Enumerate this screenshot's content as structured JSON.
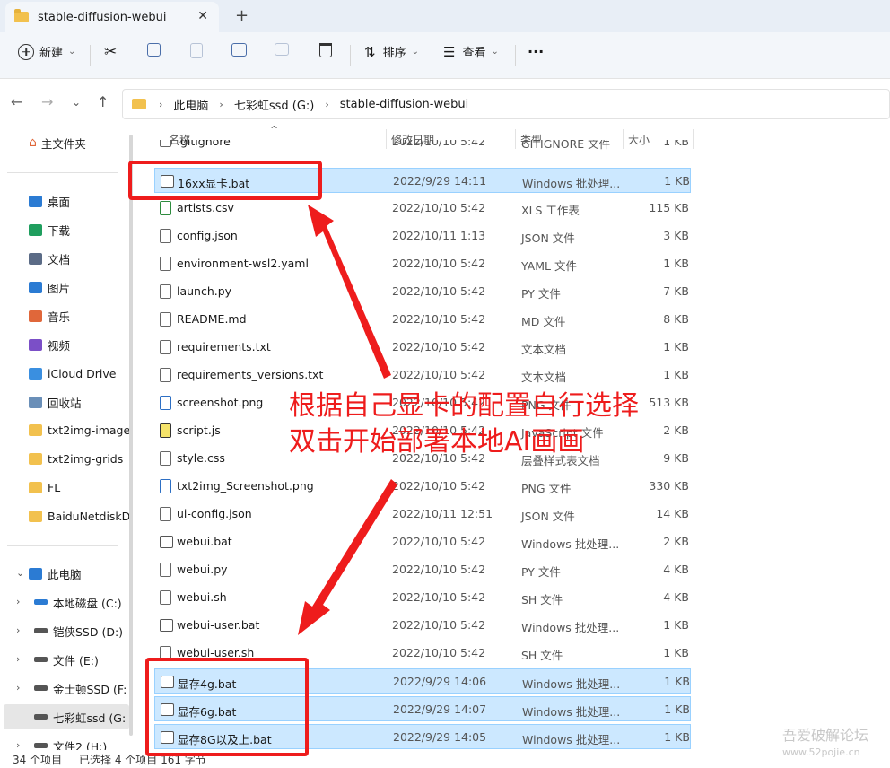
{
  "window": {
    "tab_title": "stable-diffusion-webui",
    "close_glyph": "✕",
    "new_tab_glyph": "+"
  },
  "toolbar": {
    "new_label": "新建",
    "sort_label": "排序",
    "view_label": "查看",
    "more_glyph": "···"
  },
  "address": {
    "crumbs": [
      "此电脑",
      "七彩虹ssd (G:)",
      "stable-diffusion-webui"
    ]
  },
  "sidebar": {
    "home": "主文件夹",
    "quick": [
      {
        "label": "桌面",
        "icon": "desktop-icon",
        "color": "#2b7bd3"
      },
      {
        "label": "下载",
        "icon": "download-icon",
        "color": "#1f9e5e"
      },
      {
        "label": "文档",
        "icon": "document-icon",
        "color": "#5b6b86"
      },
      {
        "label": "图片",
        "icon": "picture-icon",
        "color": "#2b7bd3"
      },
      {
        "label": "音乐",
        "icon": "music-icon",
        "color": "#e0673a"
      },
      {
        "label": "视频",
        "icon": "video-icon",
        "color": "#7b4fc7"
      },
      {
        "label": "iCloud Drive",
        "icon": "cloud-icon",
        "color": "#3a8fe0"
      },
      {
        "label": "回收站",
        "icon": "recycle-bin-icon",
        "color": "#6a8fb8"
      }
    ],
    "folders": [
      "txt2img-image",
      "txt2img-grids",
      "FL",
      "BaiduNetdiskD"
    ],
    "this_pc": "此电脑",
    "drives": [
      "本地磁盘 (C:)",
      "铠侠SSD (D:)",
      "文件 (E:)",
      "金士顿SSD (F:",
      "七彩虹ssd (G:",
      "文件2 (H:)"
    ]
  },
  "columns": {
    "name": "名称",
    "date": "修改日期",
    "type": "类型",
    "size": "大小"
  },
  "files": [
    {
      "name": ".gitignore",
      "date": "2022/10/10 5:42",
      "type": "GITIGNORE 文件",
      "size": "1 KB",
      "icon": "generic",
      "selected": false
    },
    {
      "name": "16xx显卡.bat",
      "date": "2022/9/29 14:11",
      "type": "Windows 批处理...",
      "size": "1 KB",
      "icon": "bat",
      "selected": true
    },
    {
      "name": "artists.csv",
      "date": "2022/10/10 5:42",
      "type": "XLS 工作表",
      "size": "115 KB",
      "icon": "green",
      "selected": false
    },
    {
      "name": "config.json",
      "date": "2022/10/11 1:13",
      "type": "JSON 文件",
      "size": "3 KB",
      "icon": "generic",
      "selected": false
    },
    {
      "name": "environment-wsl2.yaml",
      "date": "2022/10/10 5:42",
      "type": "YAML 文件",
      "size": "1 KB",
      "icon": "generic",
      "selected": false
    },
    {
      "name": "launch.py",
      "date": "2022/10/10 5:42",
      "type": "PY 文件",
      "size": "7 KB",
      "icon": "generic",
      "selected": false
    },
    {
      "name": "README.md",
      "date": "2022/10/10 5:42",
      "type": "MD 文件",
      "size": "8 KB",
      "icon": "generic",
      "selected": false
    },
    {
      "name": "requirements.txt",
      "date": "2022/10/10 5:42",
      "type": "文本文档",
      "size": "1 KB",
      "icon": "generic",
      "selected": false
    },
    {
      "name": "requirements_versions.txt",
      "date": "2022/10/10 5:42",
      "type": "文本文档",
      "size": "1 KB",
      "icon": "generic",
      "selected": false
    },
    {
      "name": "screenshot.png",
      "date": "2022/10/10 5:42",
      "type": "PNG 文件",
      "size": "513 KB",
      "icon": "blue",
      "selected": false
    },
    {
      "name": "script.js",
      "date": "2022/10/10 5:42",
      "type": "JavaScript 文件",
      "size": "2 KB",
      "icon": "js",
      "selected": false
    },
    {
      "name": "style.css",
      "date": "2022/10/10 5:42",
      "type": "层叠样式表文档",
      "size": "9 KB",
      "icon": "generic",
      "selected": false
    },
    {
      "name": "txt2img_Screenshot.png",
      "date": "2022/10/10 5:42",
      "type": "PNG 文件",
      "size": "330 KB",
      "icon": "blue",
      "selected": false
    },
    {
      "name": "ui-config.json",
      "date": "2022/10/11 12:51",
      "type": "JSON 文件",
      "size": "14 KB",
      "icon": "generic",
      "selected": false
    },
    {
      "name": "webui.bat",
      "date": "2022/10/10 5:42",
      "type": "Windows 批处理...",
      "size": "2 KB",
      "icon": "bat",
      "selected": false
    },
    {
      "name": "webui.py",
      "date": "2022/10/10 5:42",
      "type": "PY 文件",
      "size": "4 KB",
      "icon": "generic",
      "selected": false
    },
    {
      "name": "webui.sh",
      "date": "2022/10/10 5:42",
      "type": "SH 文件",
      "size": "4 KB",
      "icon": "generic",
      "selected": false
    },
    {
      "name": "webui-user.bat",
      "date": "2022/10/10 5:42",
      "type": "Windows 批处理...",
      "size": "1 KB",
      "icon": "bat",
      "selected": false
    },
    {
      "name": "webui-user.sh",
      "date": "2022/10/10 5:42",
      "type": "SH 文件",
      "size": "1 KB",
      "icon": "generic",
      "selected": false
    },
    {
      "name": "显存4g.bat",
      "date": "2022/9/29 14:06",
      "type": "Windows 批处理...",
      "size": "1 KB",
      "icon": "bat",
      "selected": true
    },
    {
      "name": "显存6g.bat",
      "date": "2022/9/29 14:07",
      "type": "Windows 批处理...",
      "size": "1 KB",
      "icon": "bat",
      "selected": true
    },
    {
      "name": "显存8G以及上.bat",
      "date": "2022/9/29 14:05",
      "type": "Windows 批处理...",
      "size": "1 KB",
      "icon": "bat",
      "selected": true
    }
  ],
  "status": {
    "count": "34 个项目",
    "selected": "已选择 4 个项目  161 字节"
  },
  "annotation": {
    "line1": "根据自己显卡的配置自行选择",
    "line2": "双击开始部署本地AI画画",
    "color": "#ee1c1c"
  },
  "watermark": {
    "site_name": "吾爱破解论坛",
    "site_url": "www.52pojie.cn"
  }
}
